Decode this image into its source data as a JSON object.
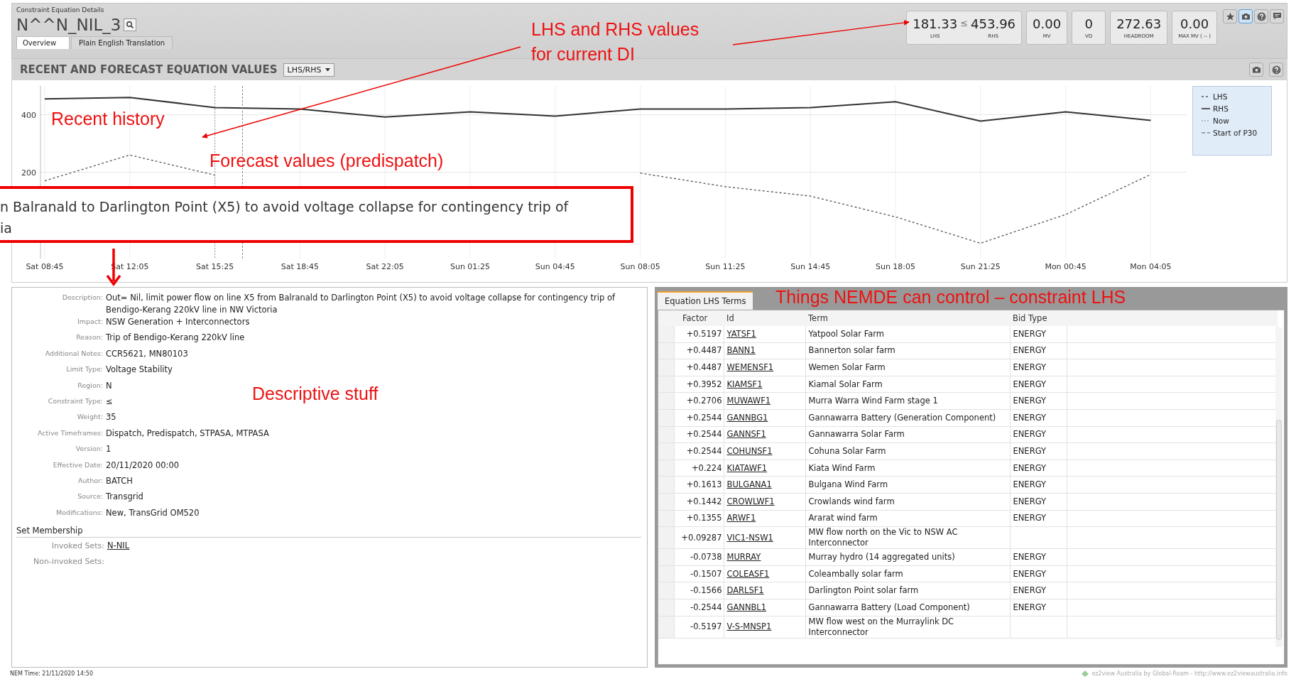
{
  "panel_label": "Constraint Equation Details",
  "title": "N^^N_NIL_3",
  "metrics": [
    {
      "kind": "pair",
      "left": {
        "value": "181.33",
        "label": "LHS"
      },
      "operator": "≤",
      "right": {
        "value": "453.96",
        "label": "RHS"
      }
    },
    {
      "kind": "single",
      "value": "0.00",
      "label": "MV"
    },
    {
      "kind": "single",
      "value": "0",
      "label": "VD"
    },
    {
      "kind": "single",
      "value": "272.63",
      "label": "HEADROOM"
    },
    {
      "kind": "single",
      "value": "0.00",
      "label": "MAX MV ( -- )"
    }
  ],
  "toolbar_icons": [
    {
      "kind": "star",
      "selected": false
    },
    {
      "kind": "camera",
      "selected": true
    },
    {
      "kind": "help",
      "selected": false
    },
    {
      "kind": "comment",
      "selected": false
    }
  ],
  "tabs": [
    {
      "label": "Overview",
      "selected": true
    },
    {
      "label": "Plain English Translation",
      "selected": false
    }
  ],
  "section": {
    "title": "RECENT AND FORECAST EQUATION VALUES",
    "dropdown": "LHS/RHS",
    "icons": [
      {
        "kind": "camera",
        "selected": false
      },
      {
        "kind": "help",
        "selected": false
      }
    ]
  },
  "chart": {
    "chart_data": {
      "type": "line",
      "categories": [
        "Sat 08:45",
        "Sat 12:05",
        "Sat 15:25",
        "Sat 18:45",
        "Sat 22:05",
        "Sun 01:25",
        "Sun 04:45",
        "Sun 08:05",
        "Sun 11:25",
        "Sun 14:45",
        "Sun 18:05",
        "Sun 21:25",
        "Mon 00:45",
        "Mon 04:05"
      ],
      "ylim": [
        -100,
        500
      ],
      "yticks": [
        200,
        400
      ],
      "series": [
        {
          "name": "LHS",
          "color": "#555555",
          "line_style": "dashed",
          "values": [
            170,
            260,
            190,
            null,
            null,
            null,
            null,
            197,
            150,
            117,
            45,
            -47,
            53,
            192
          ]
        },
        {
          "name": "RHS",
          "color": "#333333",
          "line_style": "solid",
          "values": [
            455,
            460,
            425,
            420,
            392,
            410,
            395,
            420,
            420,
            425,
            445,
            378,
            410,
            380
          ]
        }
      ],
      "grid": true,
      "ref_lines": [
        {
          "axis": "x",
          "value": "Sat 15:25",
          "label": "Now",
          "line_style": "dotted"
        }
      ]
    },
    "legend_extra": [
      {
        "label": "Start of P30",
        "kind": "dashed"
      }
    ]
  },
  "details": [
    {
      "label": "Description:",
      "value": "Out= Nil, limit power flow on line X5 from Balranald to Darlington Point (X5) to avoid voltage collapse for contingency trip of Bendigo-Kerang 220kV line in NW Victoria"
    },
    {
      "label": "Impact:",
      "value": "NSW Generation + Interconnectors"
    },
    {
      "label": "Reason:",
      "value": "Trip of Bendigo-Kerang 220kV line"
    },
    {
      "label": "Additional Notes:",
      "value": "CCR5621, MN80103"
    },
    {
      "label": "Limit Type:",
      "value": "Voltage Stability"
    },
    {
      "label": "Region:",
      "value": "N"
    },
    {
      "label": "Constraint Type:",
      "value": "≤"
    },
    {
      "label": "Weight:",
      "value": "35"
    },
    {
      "label": "Active Timeframes:",
      "value": "Dispatch, Predispatch, STPASA, MTPASA"
    },
    {
      "label": "Version:",
      "value": "1"
    },
    {
      "label": "Effective Date:",
      "value": "20/11/2020 00:00"
    },
    {
      "label": "Author:",
      "value": "BATCH"
    },
    {
      "label": "Source:",
      "value": "Transgrid"
    },
    {
      "label": "Modifications:",
      "value": "New, TransGrid OM520"
    }
  ],
  "set_membership": {
    "title": "Set Membership",
    "rows": [
      {
        "label": "Invoked Sets:",
        "value": "N-NIL"
      },
      {
        "label": "Non-invoked Sets:"
      }
    ]
  },
  "terms": {
    "tab": "Equation LHS Terms",
    "columns": [
      "Factor",
      "Id",
      "Term",
      "Bid Type"
    ],
    "rows": [
      {
        "factor": "+0.5197",
        "id": "YATSF1",
        "term": "Yatpool Solar Farm",
        "bid_type": "ENERGY"
      },
      {
        "factor": "+0.4487",
        "id": "BANN1",
        "term": "Bannerton solar farm",
        "bid_type": "ENERGY"
      },
      {
        "factor": "+0.4487",
        "id": "WEMENSF1",
        "term": "Wemen Solar Farm",
        "bid_type": "ENERGY"
      },
      {
        "factor": "+0.3952",
        "id": "KIAMSF1",
        "term": "Kiamal Solar Farm",
        "bid_type": "ENERGY"
      },
      {
        "factor": "+0.2706",
        "id": "MUWAWF1",
        "term": "Murra Warra Wind Farm stage 1",
        "bid_type": "ENERGY"
      },
      {
        "factor": "+0.2544",
        "id": "GANNBG1",
        "term": "Gannawarra Battery (Generation Component)",
        "bid_type": "ENERGY"
      },
      {
        "factor": "+0.2544",
        "id": "GANNSF1",
        "term": "Gannawarra Solar Farm",
        "bid_type": "ENERGY"
      },
      {
        "factor": "+0.2544",
        "id": "COHUNSF1",
        "term": "Cohuna Solar Farm",
        "bid_type": "ENERGY"
      },
      {
        "factor": "+0.224",
        "id": "KIATAWF1",
        "term": "Kiata Wind Farm",
        "bid_type": "ENERGY"
      },
      {
        "factor": "+0.1613",
        "id": "BULGANA1",
        "term": "Bulgana Wind Farm",
        "bid_type": "ENERGY"
      },
      {
        "factor": "+0.1442",
        "id": "CROWLWF1",
        "term": "Crowlands wind farm",
        "bid_type": "ENERGY"
      },
      {
        "factor": "+0.1355",
        "id": "ARWF1",
        "term": "Ararat wind farm",
        "bid_type": "ENERGY"
      },
      {
        "factor": "+0.09287",
        "id": "VIC1-NSW1",
        "term": "MW flow north on the Vic to NSW AC Interconnector"
      },
      {
        "factor": "-0.0738",
        "id": "MURRAY",
        "term": "Murray hydro (14 aggregated units)",
        "bid_type": "ENERGY"
      },
      {
        "factor": "-0.1507",
        "id": "COLEASF1",
        "term": "Coleambally solar farm",
        "bid_type": "ENERGY"
      },
      {
        "factor": "-0.1566",
        "id": "DARLSF1",
        "term": "Darlington Point solar farm",
        "bid_type": "ENERGY"
      },
      {
        "factor": "-0.2544",
        "id": "GANNBL1",
        "term": "Gannawarra Battery (Load Component)",
        "bid_type": "ENERGY"
      },
      {
        "factor": "-0.5197",
        "id": "V-S-MNSP1",
        "term": "MW flow west on the Murraylink DC Interconnector"
      }
    ]
  },
  "status_bar": {
    "nem_time": "NEM Time: 21/11/2020 14:50",
    "credit": "ez2view Australia by Global-Roam - http://www.ez2viewaustralia.info"
  },
  "callouts": [
    {
      "kind": "values",
      "lines": [
        "LHS and RHS values",
        "for current DI"
      ]
    },
    {
      "kind": "history",
      "lines": [
        "Recent history"
      ]
    },
    {
      "kind": "forecast",
      "lines": [
        "Forecast values (predispatch)"
      ]
    },
    {
      "kind": "descriptive",
      "lines": [
        "Descriptive stuff"
      ]
    },
    {
      "kind": "nemde",
      "lines": [
        "Things NEMDE can control – constraint LHS"
      ]
    }
  ],
  "zoom_callout": {
    "lines": [
      "n Balranald to Darlington Point (X5) to avoid voltage collapse for contingency trip of",
      "ia"
    ]
  }
}
